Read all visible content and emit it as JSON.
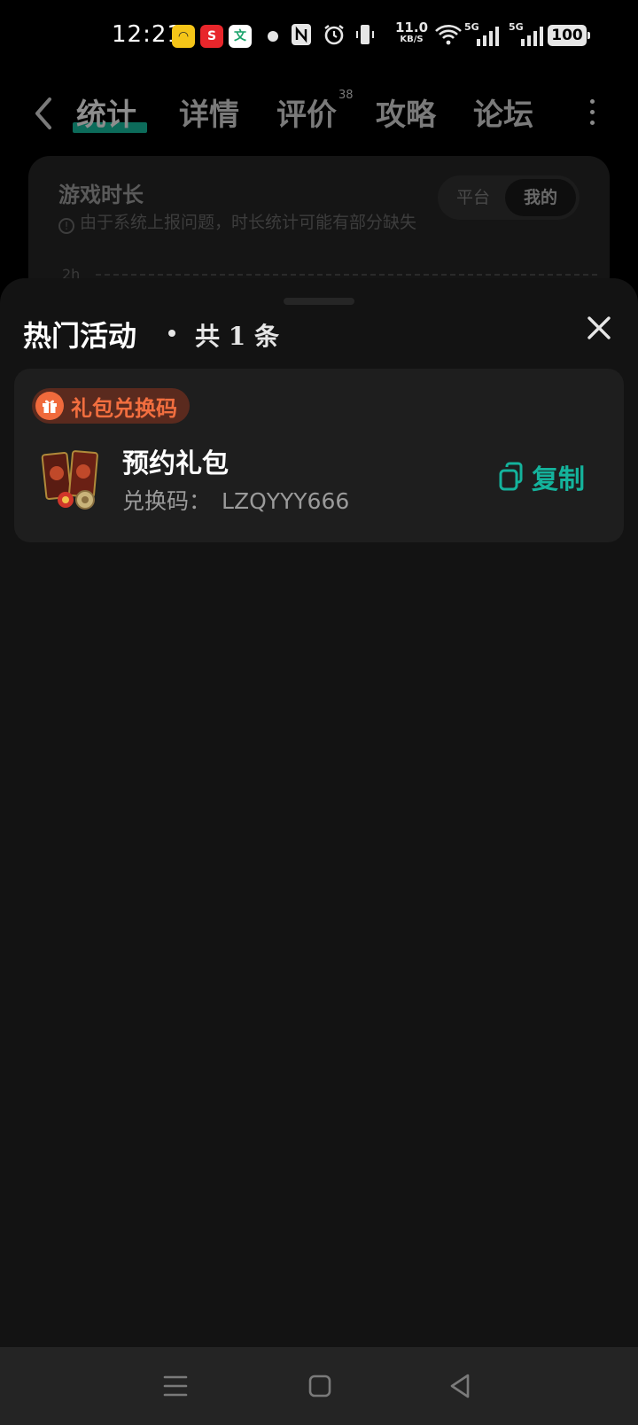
{
  "status_bar": {
    "time": "12:21",
    "net_speed_value": "11.0",
    "net_speed_unit": "KB/S",
    "sim1_label": "5G",
    "sim2_label": "5G",
    "battery": "100",
    "app_icons": [
      "yellow-app-icon",
      "red-s-app-icon",
      "wen-app-icon"
    ]
  },
  "header": {
    "tabs": [
      {
        "label": "统计",
        "active": true
      },
      {
        "label": "详情"
      },
      {
        "label": "评价",
        "badge": "38"
      },
      {
        "label": "攻略"
      },
      {
        "label": "论坛"
      }
    ]
  },
  "stats": {
    "title": "游戏时长",
    "note": "由于系统上报问题，时长统计可能有部分缺失",
    "toggle": [
      "平台",
      "我的"
    ],
    "y_axis_label": "2h"
  },
  "sheet": {
    "title": "热门活动",
    "count_label": "共 1 条",
    "card": {
      "badge_label": "礼包兑换码",
      "gift_name": "预约礼包",
      "code_label": "兑换码：",
      "code_value": "LZQYYY666",
      "copy_label": "复制"
    }
  },
  "colors": {
    "accent_green": "#14b39c",
    "badge_orange": "#f26e3f",
    "sheet_bg": "#131313",
    "card_bg": "#1e1e1e"
  }
}
